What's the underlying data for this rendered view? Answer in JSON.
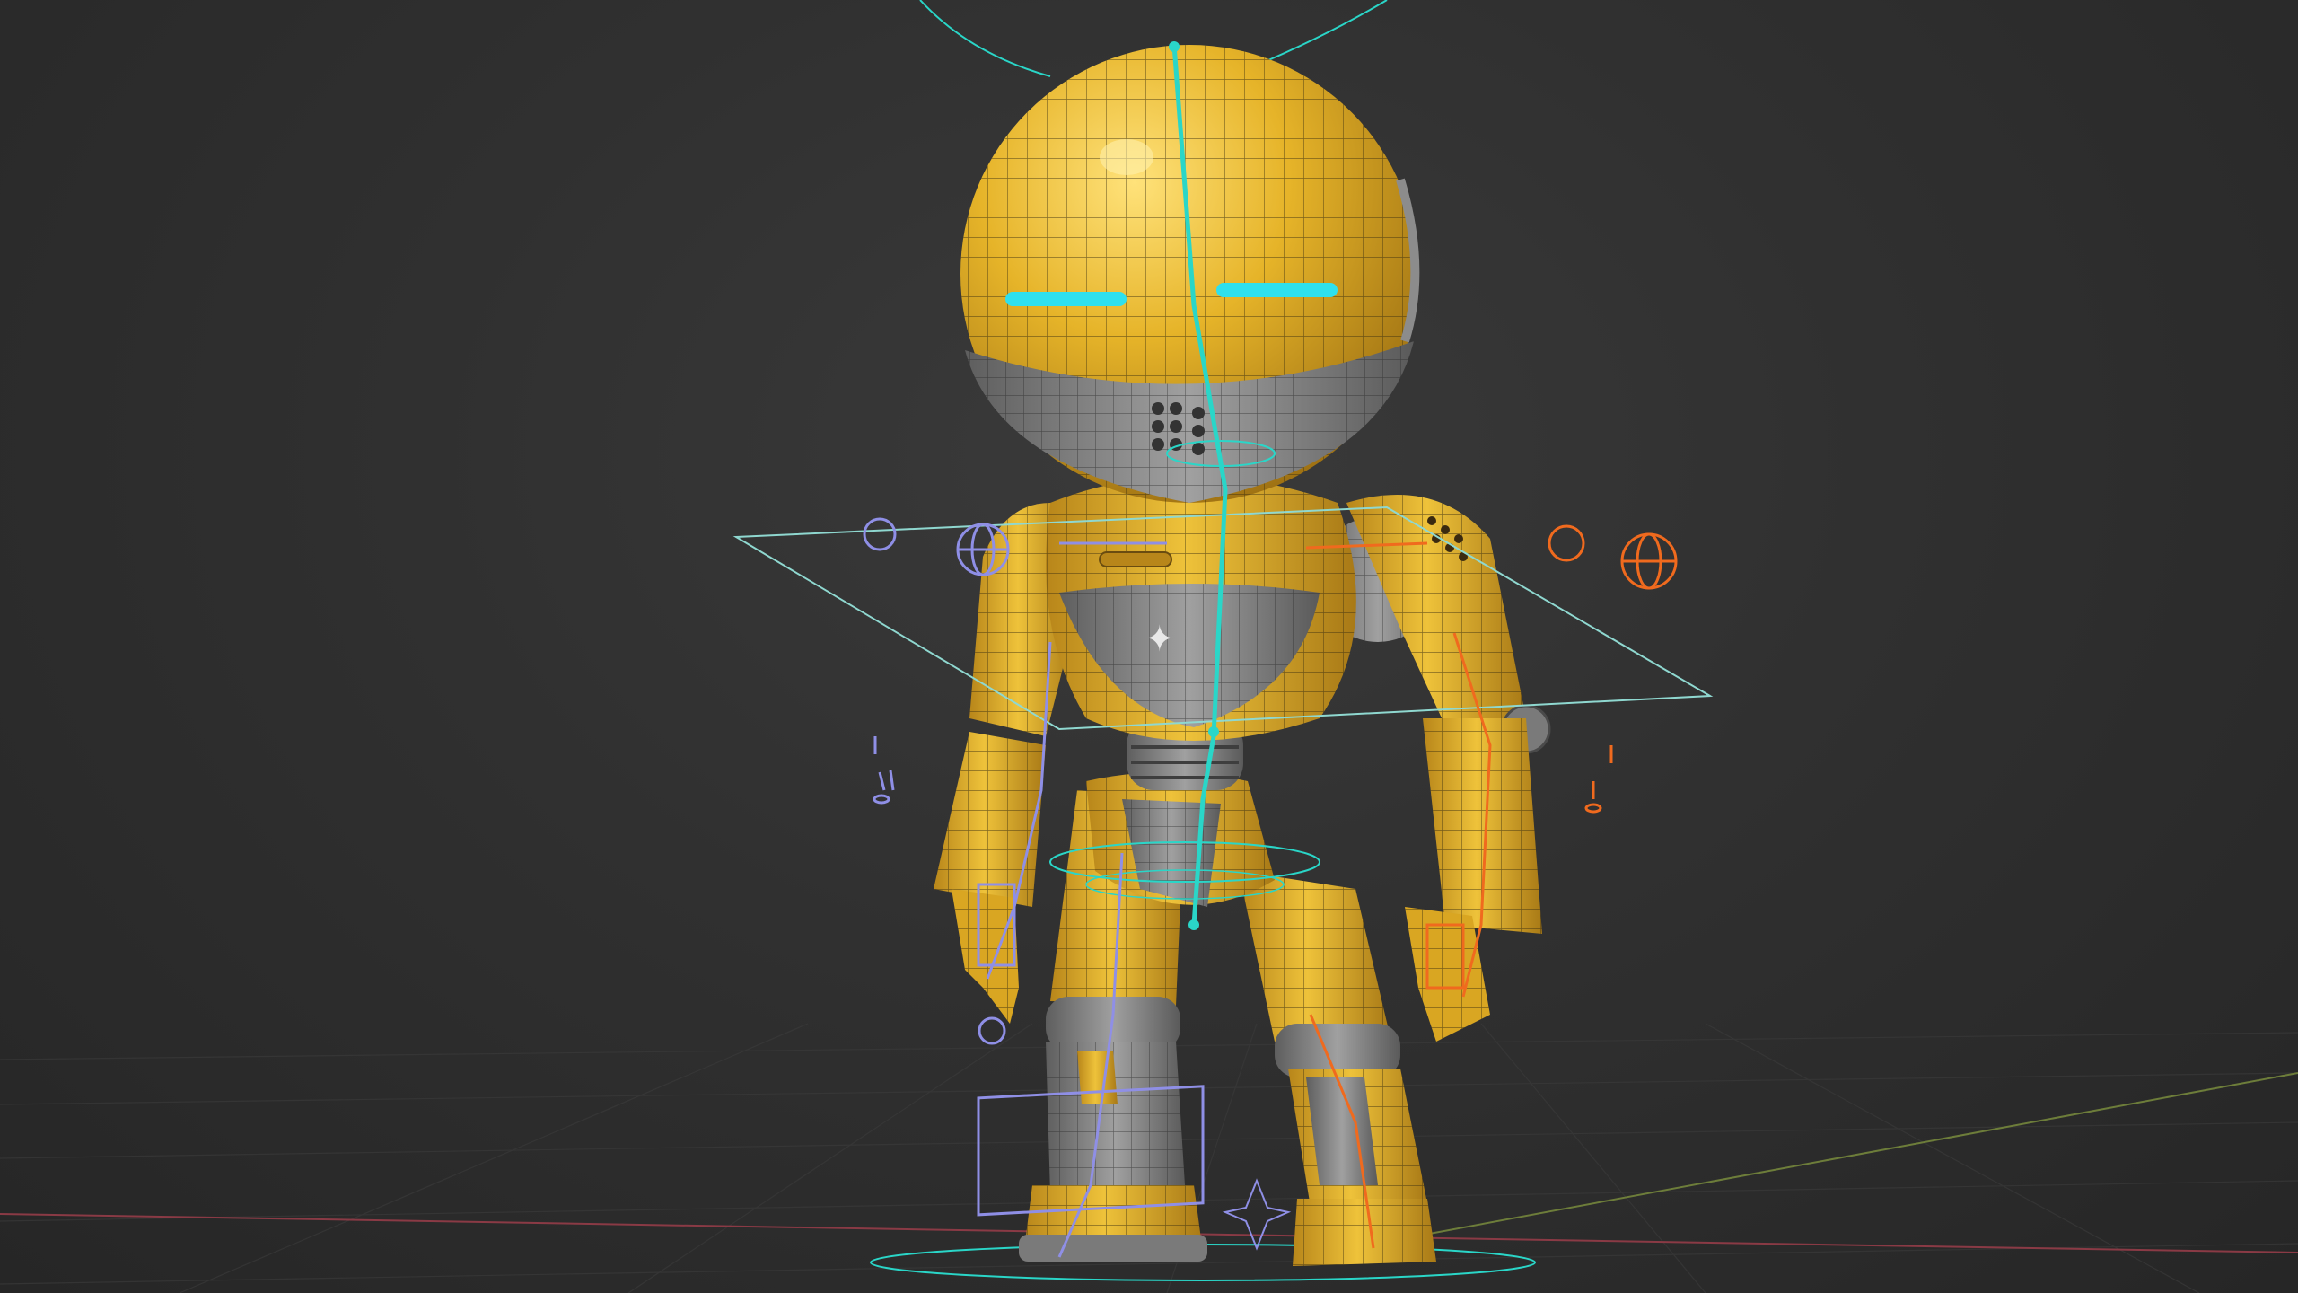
{
  "viewport": {
    "background": "#2e2e2e",
    "grid_color": "#3a3a3a",
    "axis_x_color": "#8a3a45",
    "axis_y_color": "#6d7d3a"
  },
  "robot": {
    "body_color": "#e6b429",
    "body_shadow": "#b8861a",
    "wire_color": "#3a2e10",
    "metal_color": "#8c8c8c",
    "metal_dark": "#5e5e5e",
    "eye_color": "#2fe0ee",
    "logo_symbol": "✦"
  },
  "rig": {
    "spine_color": "#2ad6c8",
    "left_color": "#8f8fe6",
    "right_color": "#f06a1e",
    "root_color": "#8fd8d0"
  }
}
